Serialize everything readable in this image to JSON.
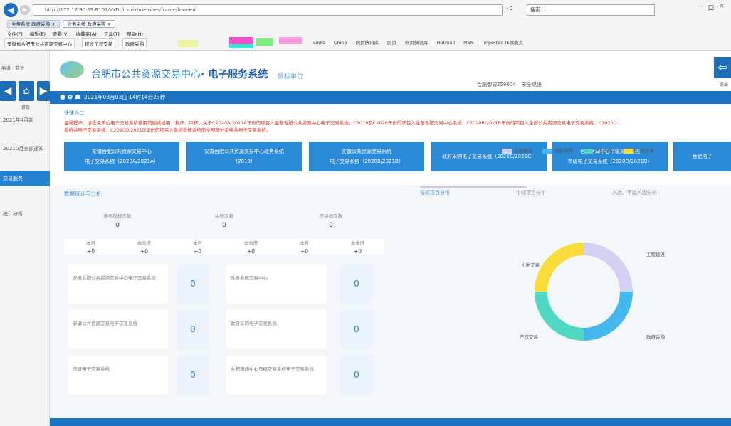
{
  "browser": {
    "url": "http://172.17.90.69:8101/YYDt/index/member/frame/frameA",
    "addr_tools": "- C",
    "search_text": "搜索...",
    "tabs": [
      "业务系统 政府采购 ×",
      "业务系统 政府采购 ×"
    ],
    "menu": [
      "文件(F)",
      "编辑(E)",
      "查看(V)",
      "收藏夹(A)",
      "工具(T)",
      "帮助(H)"
    ],
    "favorites": [
      "安徽省合肥市公共资源交易中心",
      "建设工程交易",
      "政府采购"
    ],
    "fav_right": [
      "Links",
      "China",
      "网页快讯库",
      "网页",
      "网页快讯库",
      "Hotmail",
      "MSN",
      "Imported IE收藏夹"
    ],
    "win_buttons": [
      "—",
      "口",
      "✕"
    ]
  },
  "sidebar": {
    "crumb": "后退 · 前进",
    "home_label": "首页",
    "items": [
      {
        "label": "2021年4月新",
        "style": "plain"
      },
      {
        "label": "20210月全部通知",
        "style": "plain"
      },
      {
        "label": "交易服务",
        "style": "blue"
      },
      {
        "label": "统计分析",
        "style": "plain"
      }
    ]
  },
  "header": {
    "title_prefix": "合肥市公共资源交易中心",
    "title_main": "· 电子服务系统",
    "subtitle": "投标单位",
    "user": "合肥御诚258004",
    "user_action": "安全退出",
    "exit_label": "退出"
  },
  "datebar": {
    "icons": "● ✿ ☗",
    "text": "2021年03月03日 14时14分23秒"
  },
  "notice": {
    "heading": "快速入口",
    "text_line1": "温馨提示：请投资单位电子交易系统使用前阅读说明，操作、审核、关于C2020A/2021A年份的项目入全部合肥公共资源中心电子交易系统；C2019及C2020年份的项目入全部合肥交易中心系统；C2020B/2021B年份的项目入全部公共资源交易电子交易系统；C2020D",
    "text_line2": "系统共电子交易系统，C2020D/2021D年份的项目入系统投标系统的全部部分系统共电子交易系统。"
  },
  "quick_buttons": [
    "安徽合肥公共资源交易中心|电子交易系统（2020A/2021A）",
    "安徽合肥公共资源交易中心政务系统|(2019)",
    "安徽公共资源交易系统|电子交易系统（2020B/2021B）",
    "政府采购电子交易系统（2020C/2021C）",
    "合肥新闻中心市级交易系统|市级电子交易系统（2020D/2021D）",
    "合肥电子"
  ],
  "stats": {
    "heading": "数据统计与分析",
    "chart_tabs": [
      "投标项目分析",
      "中标项目分析",
      "入选、不能入围分析"
    ],
    "top": [
      {
        "label": "参与投标次数",
        "value": "0"
      },
      {
        "label": "中标次数",
        "value": "0"
      },
      {
        "label": "不中标次数",
        "value": "0"
      }
    ],
    "sub": [
      {
        "label": "本月",
        "value": "+0"
      },
      {
        "label": "本季度",
        "value": "+0"
      },
      {
        "label": "本月",
        "value": "+0"
      },
      {
        "label": "本季度",
        "value": "+0"
      },
      {
        "label": "本月",
        "value": "+0"
      },
      {
        "label": "本季度",
        "value": "+0"
      }
    ],
    "grid": [
      {
        "label": "安徽合肥公共资源交易中心电子交易系统",
        "value": "0"
      },
      {
        "label": "政务系统交易中心",
        "value": "0"
      },
      {
        "label": "安徽公共资源交易电子交易系统",
        "value": "0"
      },
      {
        "label": "政府采购电子交易系统",
        "value": "0"
      },
      {
        "label": "市级电子交易系统",
        "value": "0"
      },
      {
        "label": "合肥新闻中心市级交易系统电子交易系统",
        "value": "0"
      }
    ]
  },
  "chart_data": {
    "type": "pie",
    "title": "",
    "series": [
      {
        "name": "工程建设",
        "value": 25,
        "color": "#d4d0f3"
      },
      {
        "name": "政府采购",
        "value": 25,
        "color": "#44b7ef"
      },
      {
        "name": "产权交易",
        "value": 25,
        "color": "#4fd7c1"
      },
      {
        "name": "土地交易",
        "value": 25,
        "color": "#f7dc3a"
      }
    ],
    "legend_position": "top"
  },
  "colors": {
    "primary": "#1b74c1",
    "accent": "#2b8ad8",
    "notice": "#d6301f"
  }
}
